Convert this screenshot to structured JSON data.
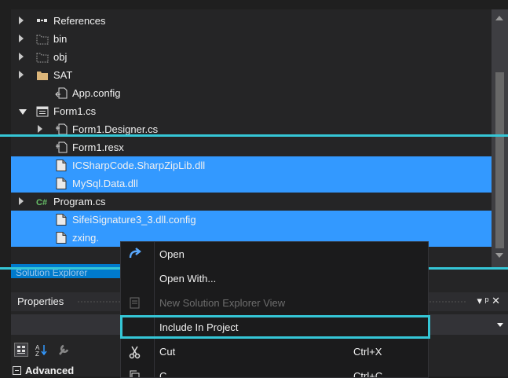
{
  "solution_explorer": {
    "items": [
      {
        "label": "References",
        "icon": "references-icon",
        "expander": "collapsed",
        "selected": false
      },
      {
        "label": "bin",
        "icon": "folder-outline-icon",
        "expander": "collapsed",
        "selected": false
      },
      {
        "label": "obj",
        "icon": "folder-outline-icon",
        "expander": "collapsed",
        "selected": false
      },
      {
        "label": "SAT",
        "icon": "folder-icon",
        "expander": "collapsed",
        "selected": false
      },
      {
        "label": "App.config",
        "icon": "config-file-icon",
        "expander": "none",
        "selected": false
      },
      {
        "label": "Form1.cs",
        "icon": "form-icon",
        "expander": "expanded",
        "selected": false
      },
      {
        "label": "Form1.Designer.cs",
        "icon": "designer-file-icon",
        "expander": "collapsed",
        "selected": false
      },
      {
        "label": "Form1.resx",
        "icon": "resx-file-icon",
        "expander": "none",
        "selected": false
      },
      {
        "label": "ICSharpCode.SharpZipLib.dll",
        "icon": "file-icon",
        "expander": "none",
        "selected": true
      },
      {
        "label": "MySql.Data.dll",
        "icon": "file-icon",
        "expander": "none",
        "selected": true
      },
      {
        "label": "Program.cs",
        "icon": "csharp-file-icon",
        "expander": "collapsed",
        "selected": false
      },
      {
        "label": "SifeiSignature3_3.dll.config",
        "icon": "file-icon",
        "expander": "none",
        "selected": true
      },
      {
        "label": "zxing.",
        "icon": "file-icon",
        "expander": "none",
        "selected": true
      }
    ],
    "tab_label": "Solution Explorer"
  },
  "properties": {
    "title": "Properties",
    "controls": "▾ ᵖ ✕"
  },
  "context_menu": {
    "items": [
      {
        "label": "Open",
        "shortcut": "",
        "icon": "open-arrow-icon",
        "disabled": false
      },
      {
        "label": "Open With...",
        "shortcut": "",
        "icon": "",
        "disabled": false
      },
      {
        "label": "New Solution Explorer View",
        "shortcut": "",
        "icon": "new-view-icon",
        "disabled": true
      },
      {
        "label": "Include In Project",
        "shortcut": "",
        "icon": "",
        "disabled": false
      },
      {
        "label": "Cut",
        "shortcut": "Ctrl+X",
        "icon": "scissors-icon",
        "disabled": false
      },
      {
        "label": "C",
        "shortcut": "Ctrl+C",
        "icon": "copy-icon",
        "disabled": false
      }
    ]
  },
  "advanced_label": "Advanced",
  "colors": {
    "selection": "#3399ff",
    "highlight": "#35c6d6",
    "background": "#252526"
  }
}
